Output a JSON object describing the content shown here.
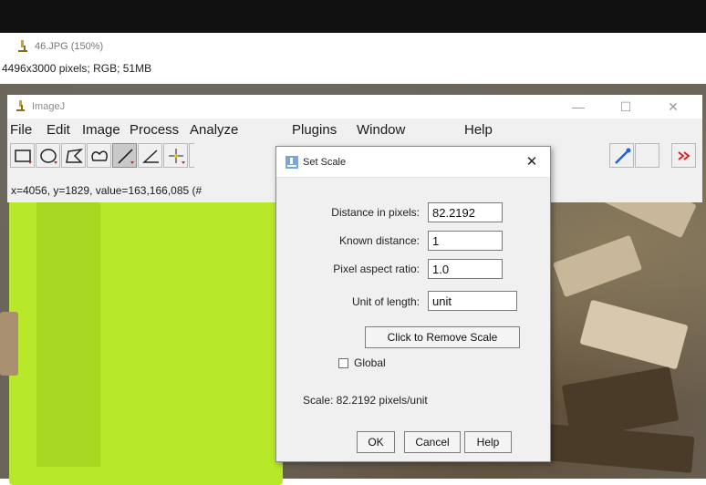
{
  "image_window": {
    "title": "46.JPG (150%)",
    "info": "4496x3000 pixels; RGB; 51MB"
  },
  "imagej": {
    "title": "ImageJ",
    "controls": {
      "minimize": "—",
      "maximize": "☐",
      "close": "✕"
    },
    "menu": [
      "File",
      "Edit",
      "Image",
      "Process",
      "Analyze",
      "Plugins",
      "Window",
      "Help"
    ],
    "tools": [
      "rectangle-tool-icon",
      "oval-tool-icon",
      "polygon-tool-icon",
      "freehand-tool-icon",
      "straight-line-tool-icon",
      "angle-tool-icon",
      "point-tool-icon",
      "wand-tool-icon",
      "dropper-tool-icon",
      "more-tools-icon"
    ],
    "selected_tool": "straight-line-tool-icon",
    "status": "x=4056, y=1829, value=163,166,085 (#"
  },
  "dialog": {
    "title": "Set Scale",
    "close": "✕",
    "fields": {
      "distance_label": "Distance in pixels:",
      "distance_value": "82.2192",
      "known_label": "Known distance:",
      "known_value": "1",
      "aspect_label": "Pixel aspect ratio:",
      "aspect_value": "1.0",
      "unit_label": "Unit of length:",
      "unit_value": "unit"
    },
    "remove_scale_button": "Click to Remove Scale",
    "global_label": "Global",
    "global_checked": false,
    "scale_text": "Scale: 82.2192 pixels/unit",
    "buttons": {
      "ok": "OK",
      "cancel": "Cancel",
      "help": "Help"
    }
  },
  "colors": {
    "accent_red": "#e02020",
    "leaf_green": "#b7e82a",
    "dropper_blue": "#2a5fcf"
  }
}
